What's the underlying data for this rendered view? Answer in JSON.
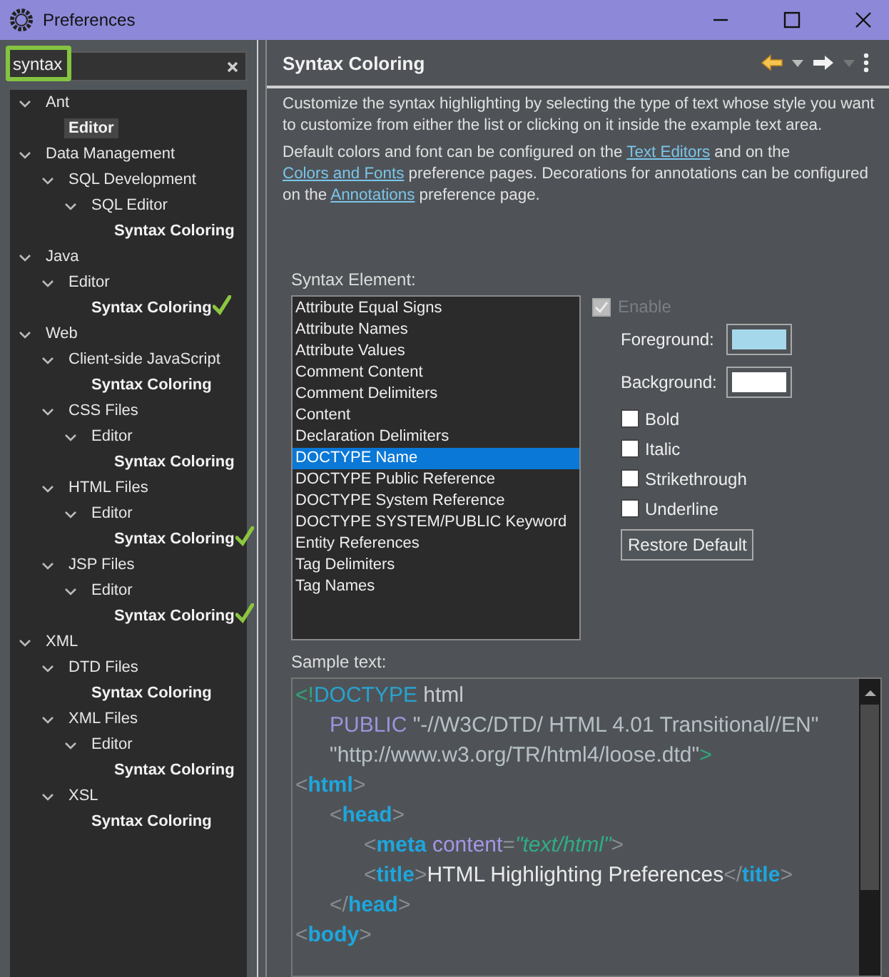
{
  "window": {
    "title": "Preferences"
  },
  "search": {
    "value": "syntax"
  },
  "tree": [
    {
      "label": "Ant",
      "expanded": true,
      "matched": false,
      "selected": false,
      "checked": false,
      "children": [
        {
          "label": "Editor",
          "matched": true,
          "selected": true,
          "checked": false
        }
      ]
    },
    {
      "label": "Data Management",
      "expanded": true,
      "matched": false,
      "selected": false,
      "checked": false,
      "children": [
        {
          "label": "SQL Development",
          "expanded": true,
          "matched": false,
          "selected": false,
          "checked": false,
          "children": [
            {
              "label": "SQL Editor",
              "expanded": true,
              "matched": false,
              "selected": false,
              "checked": false,
              "children": [
                {
                  "label": "Syntax Coloring",
                  "matched": true,
                  "selected": false,
                  "checked": false
                }
              ]
            }
          ]
        }
      ]
    },
    {
      "label": "Java",
      "expanded": true,
      "matched": false,
      "selected": false,
      "checked": false,
      "children": [
        {
          "label": "Editor",
          "expanded": true,
          "matched": false,
          "selected": false,
          "checked": false,
          "children": [
            {
              "label": "Syntax Coloring",
              "matched": true,
              "selected": false,
              "checked": true
            }
          ]
        }
      ]
    },
    {
      "label": "Web",
      "expanded": true,
      "matched": false,
      "selected": false,
      "checked": false,
      "children": [
        {
          "label": "Client-side JavaScript",
          "expanded": true,
          "matched": false,
          "selected": false,
          "checked": false,
          "children": [
            {
              "label": "Syntax Coloring",
              "matched": true,
              "selected": false,
              "checked": false
            }
          ]
        },
        {
          "label": "CSS Files",
          "expanded": true,
          "matched": false,
          "selected": false,
          "checked": false,
          "children": [
            {
              "label": "Editor",
              "expanded": true,
              "matched": false,
              "selected": false,
              "checked": false,
              "children": [
                {
                  "label": "Syntax Coloring",
                  "matched": true,
                  "selected": false,
                  "checked": false
                }
              ]
            }
          ]
        },
        {
          "label": "HTML Files",
          "expanded": true,
          "matched": false,
          "selected": false,
          "checked": false,
          "children": [
            {
              "label": "Editor",
              "expanded": true,
              "matched": false,
              "selected": false,
              "checked": false,
              "children": [
                {
                  "label": "Syntax Coloring",
                  "matched": true,
                  "selected": false,
                  "checked": true
                }
              ]
            }
          ]
        },
        {
          "label": "JSP Files",
          "expanded": true,
          "matched": false,
          "selected": false,
          "checked": false,
          "children": [
            {
              "label": "Editor",
              "expanded": true,
              "matched": false,
              "selected": false,
              "checked": false,
              "children": [
                {
                  "label": "Syntax Coloring",
                  "matched": true,
                  "selected": false,
                  "checked": true
                }
              ]
            }
          ]
        }
      ]
    },
    {
      "label": "XML",
      "expanded": true,
      "matched": false,
      "selected": false,
      "checked": false,
      "children": [
        {
          "label": "DTD Files",
          "expanded": true,
          "matched": false,
          "selected": false,
          "checked": false,
          "children": [
            {
              "label": "Syntax Coloring",
              "matched": true,
              "selected": false,
              "checked": false
            }
          ]
        },
        {
          "label": "XML Files",
          "expanded": true,
          "matched": false,
          "selected": false,
          "checked": false,
          "children": [
            {
              "label": "Editor",
              "expanded": true,
              "matched": false,
              "selected": false,
              "checked": false,
              "children": [
                {
                  "label": "Syntax Coloring",
                  "matched": true,
                  "selected": false,
                  "checked": false
                }
              ]
            }
          ]
        },
        {
          "label": "XSL",
          "expanded": true,
          "matched": false,
          "selected": false,
          "checked": false,
          "children": [
            {
              "label": "Syntax Coloring",
              "matched": true,
              "selected": false,
              "checked": false
            }
          ]
        }
      ]
    }
  ],
  "page": {
    "title": "Syntax Coloring",
    "paragraphs": [
      [
        {
          "text": "Customize the syntax highlighting by selecting the type of text whose style you want to customize from either the list or clicking on it inside the example text area.",
          "kind": "text"
        }
      ],
      [
        {
          "text": "Default colors and font can be configured on the ",
          "kind": "text"
        },
        {
          "text": "Text Editors",
          "kind": "link"
        },
        {
          "text": " and on the ",
          "kind": "text"
        },
        {
          "text": "Colors and Fonts",
          "kind": "link"
        },
        {
          "text": " preference pages.  Decorations for annotations can be configured on the ",
          "kind": "text"
        },
        {
          "text": "Annotations",
          "kind": "link"
        },
        {
          "text": " preference page.",
          "kind": "text"
        }
      ]
    ],
    "elements_label": "Syntax Element:",
    "elements": [
      {
        "label": "Attribute Equal Signs",
        "selected": false
      },
      {
        "label": "Attribute Names",
        "selected": false
      },
      {
        "label": "Attribute Values",
        "selected": false
      },
      {
        "label": "Comment Content",
        "selected": false
      },
      {
        "label": "Comment Delimiters",
        "selected": false
      },
      {
        "label": "Content",
        "selected": false
      },
      {
        "label": "Declaration Delimiters",
        "selected": false
      },
      {
        "label": "DOCTYPE Name",
        "selected": true
      },
      {
        "label": "DOCTYPE Public Reference",
        "selected": false
      },
      {
        "label": "DOCTYPE System Reference",
        "selected": false
      },
      {
        "label": "DOCTYPE SYSTEM/PUBLIC Keyword",
        "selected": false
      },
      {
        "label": "Entity References",
        "selected": false
      },
      {
        "label": "Tag Delimiters",
        "selected": false
      },
      {
        "label": "Tag Names",
        "selected": false
      }
    ],
    "enable": {
      "label": "Enable",
      "checked": true,
      "disabled": true
    },
    "colors": [
      {
        "label": "Foreground:",
        "color": "#a6d8ec"
      },
      {
        "label": "Background:",
        "color": "#ffffff"
      }
    ],
    "styles": [
      {
        "label": "Bold",
        "checked": false
      },
      {
        "label": "Italic",
        "checked": false
      },
      {
        "label": "Strikethrough",
        "checked": false
      },
      {
        "label": "Underline",
        "checked": false
      }
    ],
    "restore_button": "Restore Default",
    "sample_label": "Sample text:",
    "sample": [
      {
        "tokens": [
          {
            "text": "<!",
            "kind": "decl"
          },
          {
            "text": "DOCTYPE",
            "kind": "doctype"
          },
          {
            "text": " html",
            "kind": "plain"
          }
        ],
        "children": [
          {
            "tokens": [
              {
                "text": "PUBLIC",
                "kind": "keyword"
              },
              {
                "text": " \"-//W3C/DTD/ HTML 4.01 Transitional//EN\"",
                "kind": "string"
              }
            ]
          },
          {
            "tokens": [
              {
                "text": "\"http://www.w3.org/TR/html4/loose.dtd\"",
                "kind": "string"
              },
              {
                "text": ">",
                "kind": "decl"
              }
            ]
          }
        ]
      },
      {
        "tokens": [
          {
            "text": "<",
            "kind": "delim"
          },
          {
            "text": "html",
            "kind": "tag"
          },
          {
            "text": ">",
            "kind": "delim"
          }
        ],
        "children": [
          {
            "tokens": [
              {
                "text": "<",
                "kind": "delim"
              },
              {
                "text": "head",
                "kind": "tag"
              },
              {
                "text": ">",
                "kind": "delim"
              }
            ],
            "children": [
              {
                "tokens": [
                  {
                    "text": "<",
                    "kind": "delim"
                  },
                  {
                    "text": "meta",
                    "kind": "tag"
                  },
                  {
                    "text": " content",
                    "kind": "attr"
                  },
                  {
                    "text": "=",
                    "kind": "delim"
                  },
                  {
                    "text": "\"text/html\"",
                    "kind": "value"
                  },
                  {
                    "text": ">",
                    "kind": "delim"
                  }
                ]
              },
              {
                "tokens": [
                  {
                    "text": "<",
                    "kind": "delim"
                  },
                  {
                    "text": "title",
                    "kind": "tag"
                  },
                  {
                    "text": ">",
                    "kind": "delim"
                  },
                  {
                    "text": "HTML Highlighting Preferences",
                    "kind": "content"
                  },
                  {
                    "text": "</",
                    "kind": "delim"
                  },
                  {
                    "text": "title",
                    "kind": "tag"
                  },
                  {
                    "text": ">",
                    "kind": "delim"
                  }
                ]
              }
            ]
          },
          {
            "tokens": [
              {
                "text": "</",
                "kind": "delim"
              },
              {
                "text": "head",
                "kind": "tag"
              },
              {
                "text": ">",
                "kind": "delim"
              }
            ]
          }
        ]
      },
      {
        "tokens": [
          {
            "text": "<",
            "kind": "delim"
          },
          {
            "text": "body",
            "kind": "tag"
          },
          {
            "text": ">",
            "kind": "delim"
          }
        ]
      }
    ]
  }
}
